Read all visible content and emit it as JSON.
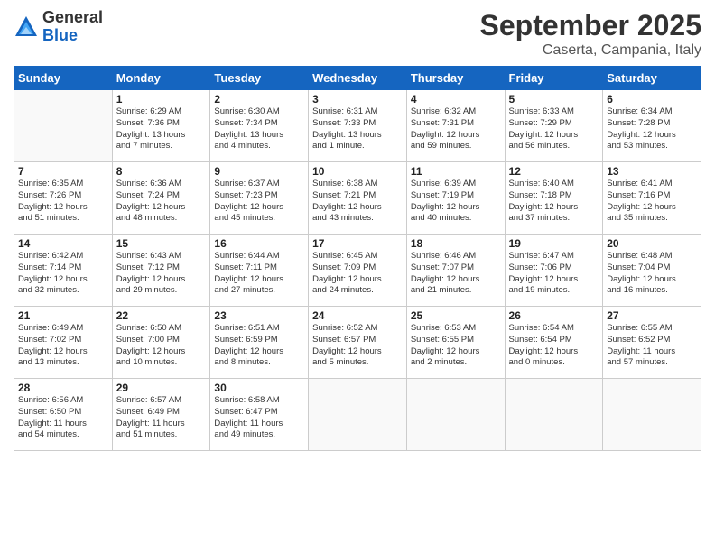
{
  "logo": {
    "general": "General",
    "blue": "Blue"
  },
  "title": "September 2025",
  "subtitle": "Caserta, Campania, Italy",
  "days_of_week": [
    "Sunday",
    "Monday",
    "Tuesday",
    "Wednesday",
    "Thursday",
    "Friday",
    "Saturday"
  ],
  "weeks": [
    [
      {
        "day": "",
        "info": ""
      },
      {
        "day": "1",
        "info": "Sunrise: 6:29 AM\nSunset: 7:36 PM\nDaylight: 13 hours\nand 7 minutes."
      },
      {
        "day": "2",
        "info": "Sunrise: 6:30 AM\nSunset: 7:34 PM\nDaylight: 13 hours\nand 4 minutes."
      },
      {
        "day": "3",
        "info": "Sunrise: 6:31 AM\nSunset: 7:33 PM\nDaylight: 13 hours\nand 1 minute."
      },
      {
        "day": "4",
        "info": "Sunrise: 6:32 AM\nSunset: 7:31 PM\nDaylight: 12 hours\nand 59 minutes."
      },
      {
        "day": "5",
        "info": "Sunrise: 6:33 AM\nSunset: 7:29 PM\nDaylight: 12 hours\nand 56 minutes."
      },
      {
        "day": "6",
        "info": "Sunrise: 6:34 AM\nSunset: 7:28 PM\nDaylight: 12 hours\nand 53 minutes."
      }
    ],
    [
      {
        "day": "7",
        "info": "Sunrise: 6:35 AM\nSunset: 7:26 PM\nDaylight: 12 hours\nand 51 minutes."
      },
      {
        "day": "8",
        "info": "Sunrise: 6:36 AM\nSunset: 7:24 PM\nDaylight: 12 hours\nand 48 minutes."
      },
      {
        "day": "9",
        "info": "Sunrise: 6:37 AM\nSunset: 7:23 PM\nDaylight: 12 hours\nand 45 minutes."
      },
      {
        "day": "10",
        "info": "Sunrise: 6:38 AM\nSunset: 7:21 PM\nDaylight: 12 hours\nand 43 minutes."
      },
      {
        "day": "11",
        "info": "Sunrise: 6:39 AM\nSunset: 7:19 PM\nDaylight: 12 hours\nand 40 minutes."
      },
      {
        "day": "12",
        "info": "Sunrise: 6:40 AM\nSunset: 7:18 PM\nDaylight: 12 hours\nand 37 minutes."
      },
      {
        "day": "13",
        "info": "Sunrise: 6:41 AM\nSunset: 7:16 PM\nDaylight: 12 hours\nand 35 minutes."
      }
    ],
    [
      {
        "day": "14",
        "info": "Sunrise: 6:42 AM\nSunset: 7:14 PM\nDaylight: 12 hours\nand 32 minutes."
      },
      {
        "day": "15",
        "info": "Sunrise: 6:43 AM\nSunset: 7:12 PM\nDaylight: 12 hours\nand 29 minutes."
      },
      {
        "day": "16",
        "info": "Sunrise: 6:44 AM\nSunset: 7:11 PM\nDaylight: 12 hours\nand 27 minutes."
      },
      {
        "day": "17",
        "info": "Sunrise: 6:45 AM\nSunset: 7:09 PM\nDaylight: 12 hours\nand 24 minutes."
      },
      {
        "day": "18",
        "info": "Sunrise: 6:46 AM\nSunset: 7:07 PM\nDaylight: 12 hours\nand 21 minutes."
      },
      {
        "day": "19",
        "info": "Sunrise: 6:47 AM\nSunset: 7:06 PM\nDaylight: 12 hours\nand 19 minutes."
      },
      {
        "day": "20",
        "info": "Sunrise: 6:48 AM\nSunset: 7:04 PM\nDaylight: 12 hours\nand 16 minutes."
      }
    ],
    [
      {
        "day": "21",
        "info": "Sunrise: 6:49 AM\nSunset: 7:02 PM\nDaylight: 12 hours\nand 13 minutes."
      },
      {
        "day": "22",
        "info": "Sunrise: 6:50 AM\nSunset: 7:00 PM\nDaylight: 12 hours\nand 10 minutes."
      },
      {
        "day": "23",
        "info": "Sunrise: 6:51 AM\nSunset: 6:59 PM\nDaylight: 12 hours\nand 8 minutes."
      },
      {
        "day": "24",
        "info": "Sunrise: 6:52 AM\nSunset: 6:57 PM\nDaylight: 12 hours\nand 5 minutes."
      },
      {
        "day": "25",
        "info": "Sunrise: 6:53 AM\nSunset: 6:55 PM\nDaylight: 12 hours\nand 2 minutes."
      },
      {
        "day": "26",
        "info": "Sunrise: 6:54 AM\nSunset: 6:54 PM\nDaylight: 12 hours\nand 0 minutes."
      },
      {
        "day": "27",
        "info": "Sunrise: 6:55 AM\nSunset: 6:52 PM\nDaylight: 11 hours\nand 57 minutes."
      }
    ],
    [
      {
        "day": "28",
        "info": "Sunrise: 6:56 AM\nSunset: 6:50 PM\nDaylight: 11 hours\nand 54 minutes."
      },
      {
        "day": "29",
        "info": "Sunrise: 6:57 AM\nSunset: 6:49 PM\nDaylight: 11 hours\nand 51 minutes."
      },
      {
        "day": "30",
        "info": "Sunrise: 6:58 AM\nSunset: 6:47 PM\nDaylight: 11 hours\nand 49 minutes."
      },
      {
        "day": "",
        "info": ""
      },
      {
        "day": "",
        "info": ""
      },
      {
        "day": "",
        "info": ""
      },
      {
        "day": "",
        "info": ""
      }
    ]
  ]
}
